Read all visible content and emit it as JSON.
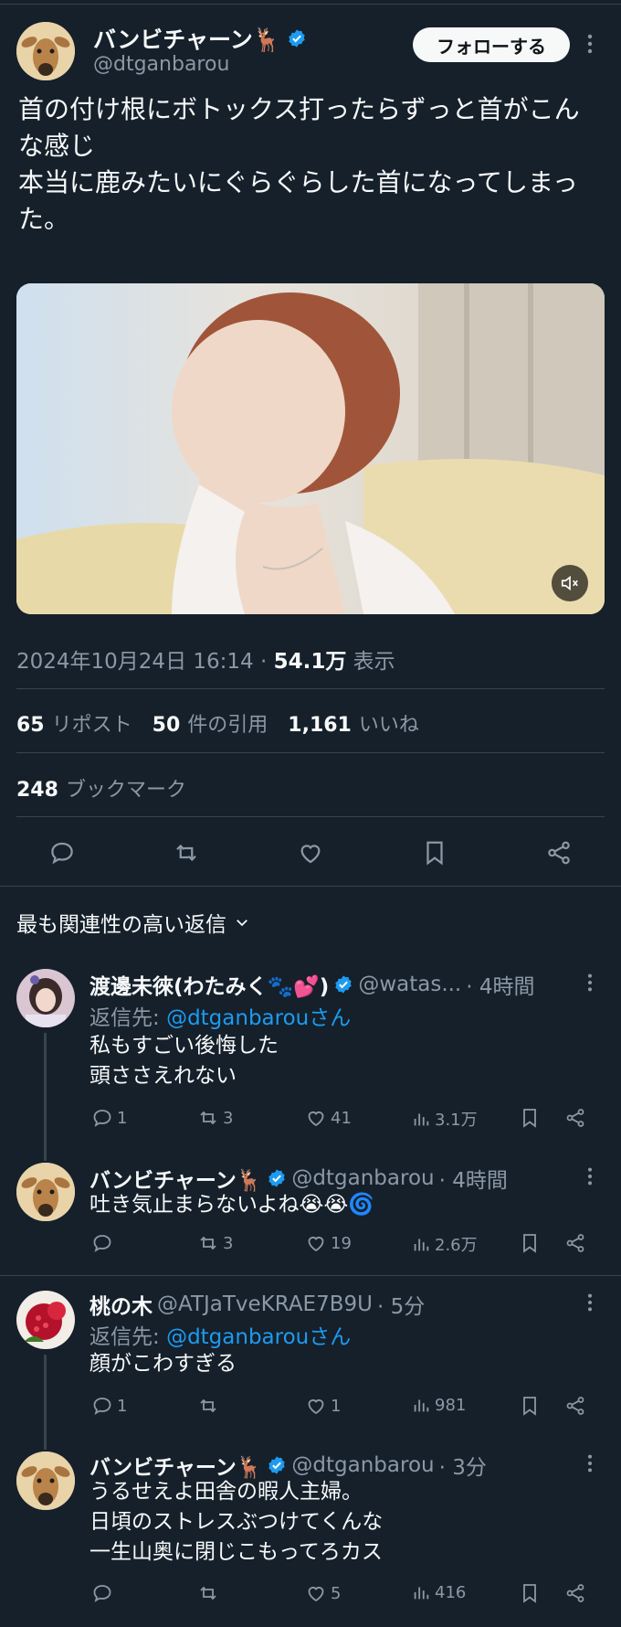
{
  "main_tweet": {
    "name": "バンビチャーン🦌",
    "handle": "@dtganbarou",
    "follow_label": "フォローする",
    "text": "首の付け根にボトックス打ったらずっと首がこんな感じ\n本当に鹿みたいにぐらぐらした首になってしまった。",
    "timestamp": "2024年10月24日 16:14 · ",
    "views": "54.1万",
    "views_label": " 表示",
    "reposts": "65",
    "reposts_label": "リポスト",
    "quotes": "50",
    "quotes_label": "件の引用",
    "likes": "1,161",
    "likes_label": "いいね",
    "bookmarks": "248",
    "bookmarks_label": "ブックマーク"
  },
  "sort_label": "最も関連性の高い返信",
  "icons": {
    "more": "more-vertical-icon",
    "verified": "verified-badge-icon",
    "mute": "speaker-muted-icon",
    "reply": "reply-icon",
    "repost": "repost-icon",
    "like": "heart-icon",
    "views": "bar-chart-icon",
    "bookmark": "bookmark-icon",
    "share": "share-icon",
    "chevron": "chevron-down-icon"
  },
  "colors": {
    "background": "#15202b",
    "accent": "#1d9bf0",
    "muted": "#8b98a5",
    "divider": "#38444d"
  },
  "replies": [
    {
      "name": "渡邊未徠(わたみく🐾💕)",
      "handle": "@watas...",
      "time": "· 4時間",
      "reply_to_prefix": "返信先: ",
      "reply_to": "@dtganbarouさん",
      "text": "私もすごい後悔した\n頭ささえれない",
      "replies": "1",
      "reposts": "3",
      "likes": "41",
      "views": "3.1万"
    },
    {
      "name": "バンビチャーン🦌",
      "handle": "@dtganbarou",
      "time": "· 4時間",
      "text": "吐き気止まらないよね😭😭🌀",
      "replies": "",
      "reposts": "3",
      "likes": "19",
      "views": "2.6万"
    },
    {
      "name": "桃の木",
      "handle": "@ATJaTveKRAE7B9U",
      "time": "· 5分",
      "reply_to_prefix": "返信先: ",
      "reply_to": "@dtganbarouさん",
      "text": "顔がこわすぎる",
      "replies": "1",
      "reposts": "",
      "likes": "1",
      "views": "981"
    },
    {
      "name": "バンビチャーン🦌",
      "handle": "@dtganbarou",
      "time": "· 3分",
      "text": "うるせえよ田舎の暇人主婦。\n日頃のストレスぶつけてくんな\n一生山奥に閉じこもってろカス",
      "replies": "",
      "reposts": "",
      "likes": "5",
      "views": "416"
    }
  ]
}
